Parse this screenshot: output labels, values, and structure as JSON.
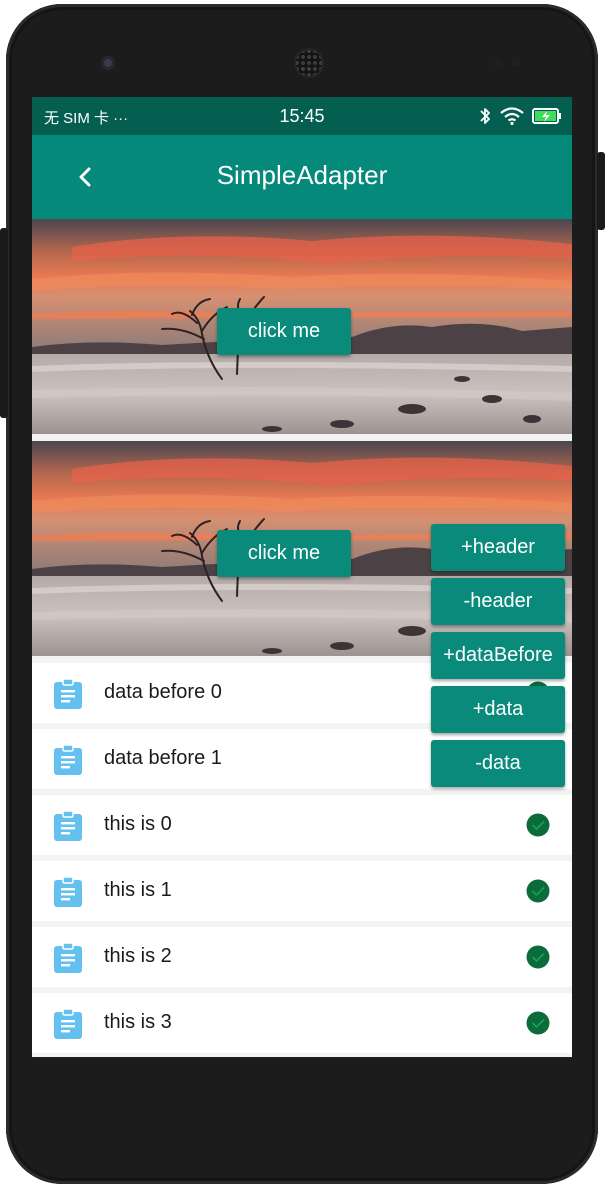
{
  "status_bar": {
    "carrier": "无 SIM 卡 ···",
    "time": "15:45"
  },
  "toolbar": {
    "title": "SimpleAdapter"
  },
  "headers": [
    {
      "button_label": "click me"
    },
    {
      "button_label": "click me"
    }
  ],
  "list": {
    "items": [
      {
        "label": "data before 0",
        "icon": "clipboard-icon",
        "checked": true
      },
      {
        "label": "data before 1",
        "icon": "clipboard-icon",
        "checked": true
      },
      {
        "label": "this is 0",
        "icon": "clipboard-icon",
        "checked": true
      },
      {
        "label": "this is 1",
        "icon": "clipboard-icon",
        "checked": true
      },
      {
        "label": "this is 2",
        "icon": "clipboard-icon",
        "checked": true
      },
      {
        "label": "this is 3",
        "icon": "clipboard-icon",
        "checked": true
      }
    ]
  },
  "actions": {
    "add_header": "+header",
    "remove_header": "-header",
    "add_data_before": "+dataBefore",
    "add_data": "+data",
    "remove_data": "-data"
  },
  "colors": {
    "status_bar": "#045f51",
    "toolbar": "#05897a",
    "button": "#0a8a7b",
    "icon_blue": "#63c0ef",
    "check_green": "#0b6b3a"
  }
}
